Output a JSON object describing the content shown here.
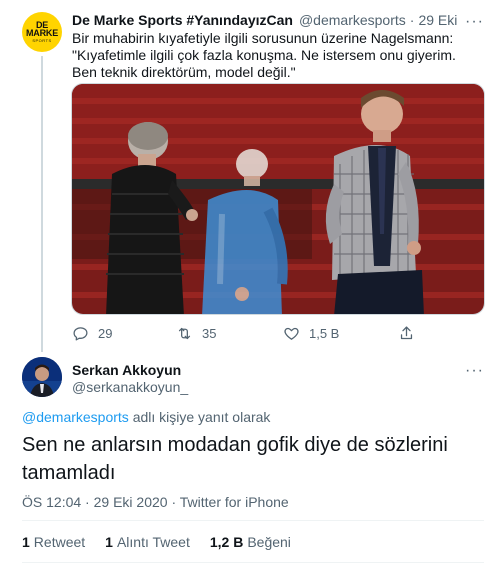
{
  "parent_tweet": {
    "avatar_text": {
      "line1": "DE",
      "line2": "MARKE",
      "line3": "SPORTS"
    },
    "display_name": "De Marke Sports #YanındayızCan",
    "handle": "@demarkesports",
    "separator": "·",
    "date": "29 Eki",
    "text": "Bir muhabirin kıyafetiyle ilgili sorusunun üzerine Nagelsmann: \"Kıyafetimle ilgili çok fazla konuşma. Ne istersem onu giyerim. Ben teknik direktörüm, model değil.\"",
    "actions": {
      "reply_count": "29",
      "retweet_count": "35",
      "like_count": "1,5 B"
    }
  },
  "reply_tweet": {
    "display_name": "Serkan Akkoyun",
    "handle": "@serkanakkoyun_",
    "reply_to_mention": "@demarkesports",
    "reply_to_suffix": " adlı kişiye yanıt olarak",
    "text": "Sen ne anlarsın modadan gofik diye de sözlerini tamamladı",
    "time": "ÖS 12:04",
    "separator": "·",
    "date": "29 Eki 2020",
    "source": "Twitter for iPhone",
    "stats": {
      "retweets_value": "1",
      "retweets_label": "Retweet",
      "quotes_value": "1",
      "quotes_label": "Alıntı Tweet",
      "likes_value": "1,2 B",
      "likes_label": "Beğeni"
    }
  },
  "colors": {
    "accent": "#1d9bf0",
    "text_primary": "#0f1419",
    "text_secondary": "#536471",
    "avatar_yellow": "#ffd400"
  },
  "icons": [
    "more-icon",
    "reply-icon",
    "retweet-icon",
    "like-icon",
    "share-icon"
  ]
}
